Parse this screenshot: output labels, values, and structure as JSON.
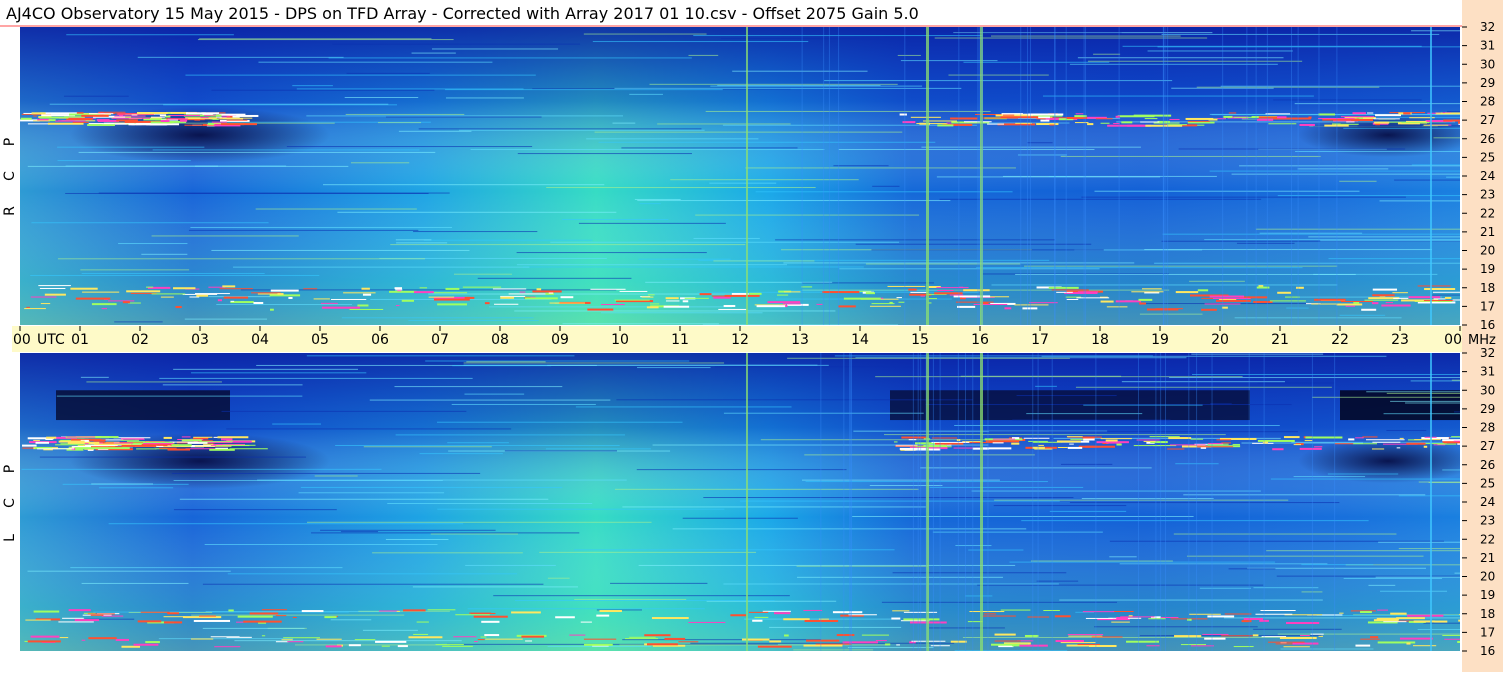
{
  "title": "AJ4CO Observatory  15 May 2015  -  DPS on TFD Array  -  Corrected with Array 2017 01 10.csv  -  Offset 2075  Gain 5.0",
  "time_axis": {
    "labels": [
      "00",
      "01",
      "02",
      "03",
      "04",
      "05",
      "06",
      "07",
      "08",
      "09",
      "10",
      "11",
      "12",
      "13",
      "14",
      "15",
      "16",
      "17",
      "18",
      "19",
      "20",
      "21",
      "22",
      "23",
      "00"
    ],
    "unit_left": "UTC",
    "unit_right": "MHz"
  },
  "colors": {
    "background": "#ffffff",
    "time_band": "#fefac8",
    "right_band": "#fde0c4",
    "title_border": "#ff4b4b"
  },
  "chart_data": [
    {
      "type": "heatmap",
      "panel": "upper",
      "label_letters": [
        "R",
        "C",
        "P"
      ],
      "x": {
        "label": "UTC",
        "range": [
          0,
          24
        ]
      },
      "y": {
        "label": "MHz",
        "range": [
          16,
          32
        ],
        "ticks": [
          16,
          17,
          18,
          19,
          20,
          21,
          22,
          23,
          24,
          25,
          26,
          27,
          28,
          29,
          30,
          31,
          32
        ]
      },
      "features": {
        "strong_bands_mhz": [
          17.2,
          17.8,
          27.1
        ],
        "vertical_interference_utc": [
          12.1,
          15.1,
          16.0,
          23.5
        ]
      }
    },
    {
      "type": "heatmap",
      "panel": "lower",
      "label_letters": [
        "L",
        "C",
        "P"
      ],
      "x": {
        "label": "UTC",
        "range": [
          0,
          24
        ]
      },
      "y": {
        "label": "MHz",
        "range": [
          16,
          32
        ],
        "ticks": [
          16,
          17,
          18,
          19,
          20,
          21,
          22,
          23,
          24,
          25,
          26,
          27,
          28,
          29,
          30,
          31,
          32
        ]
      },
      "features": {
        "strong_bands_mhz": [
          16.6,
          17.9,
          27.2
        ],
        "vertical_interference_utc": [
          12.1,
          15.1,
          16.0,
          23.5
        ]
      }
    }
  ]
}
